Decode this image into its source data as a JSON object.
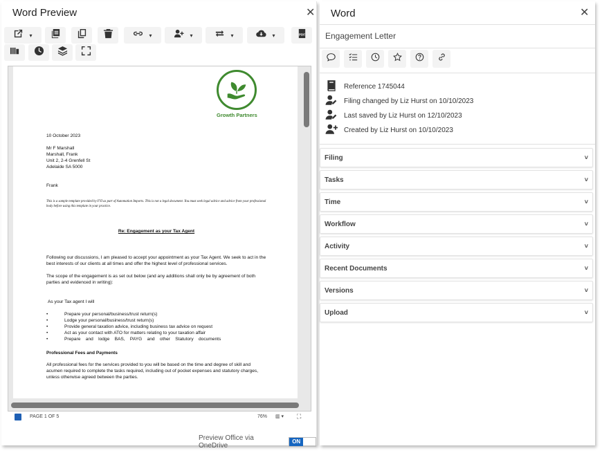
{
  "left_panel": {
    "title": "Word Preview",
    "close_glyph": "✕",
    "toolbar": {
      "dropdown_glyph": "▾"
    }
  },
  "document": {
    "logo_text": "Growth Partners",
    "date": "10 October 2023",
    "address": [
      "Mr F Marshall",
      "Marshall, Frank",
      "Unit 2, 2-4 Grenfell St",
      "Adelaide SA 5000"
    ],
    "salutation": "Frank",
    "disclaimer": "This is a sample template provided by FYI as part of Automation Imports. This is not a legal document. You must seek legal advice and advice from your professional body before using this template in your practice.",
    "subject": "Re: Engagement as your Tax Agent",
    "para1": "Following our discussions, I am pleased to accept your appointment as your Tax Agent.  We seek to act in the best interests of our clients at all times and offer the highest level of professional services.",
    "para2": "The scope of the engagement is as set out below (and any additions shall only be by agreement of both parties and evidenced in writing):",
    "intro": "As your Tax agent I will",
    "bullets": [
      "Prepare your personal/business/trust return(s)",
      "Lodge your personal/business/trust return(s)",
      "Provide general taxation advice, including business tax advice on request",
      "Act as your contact with ATO for matters relating to your taxation affair",
      "Prepare    and    lodge    BAS,    PAYG    and    other    Statutory    documents"
    ],
    "fees_heading": "Professional Fees and Payments",
    "fees_para": "All professional fees for the services provided to you will be based on the time and degree of skill and acumen required to complete the tasks required, including out of pocket expenses and statutory charges, unless otherwise agreed between the parties."
  },
  "status_bar": {
    "page": "PAGE 1 OF 5",
    "zoom": "76%",
    "view_glyph": "▥ ▾",
    "fullscreen_glyph": "⛶"
  },
  "footer": {
    "onedrive_label": "Preview Office via OneDrive",
    "toggle_on": "ON"
  },
  "right_panel": {
    "title": "Word",
    "close_glyph": "✕",
    "doc_name": "Engagement Letter",
    "meta": {
      "reference": "Reference 1745044",
      "filing_changed": "Filing changed by Liz Hurst on 10/10/2023",
      "last_saved": "Last saved by Liz Hurst on 12/10/2023",
      "created": "Created by Liz Hurst on 10/10/2023"
    },
    "chevron_glyph": "˅",
    "sections": [
      "Filing",
      "Tasks",
      "Time",
      "Workflow",
      "Activity",
      "Recent Documents",
      "Versions",
      "Upload"
    ]
  },
  "colors": {
    "accent": "#1565c0",
    "logo_green": "#3f8a2f",
    "icon_dark": "#333333"
  }
}
